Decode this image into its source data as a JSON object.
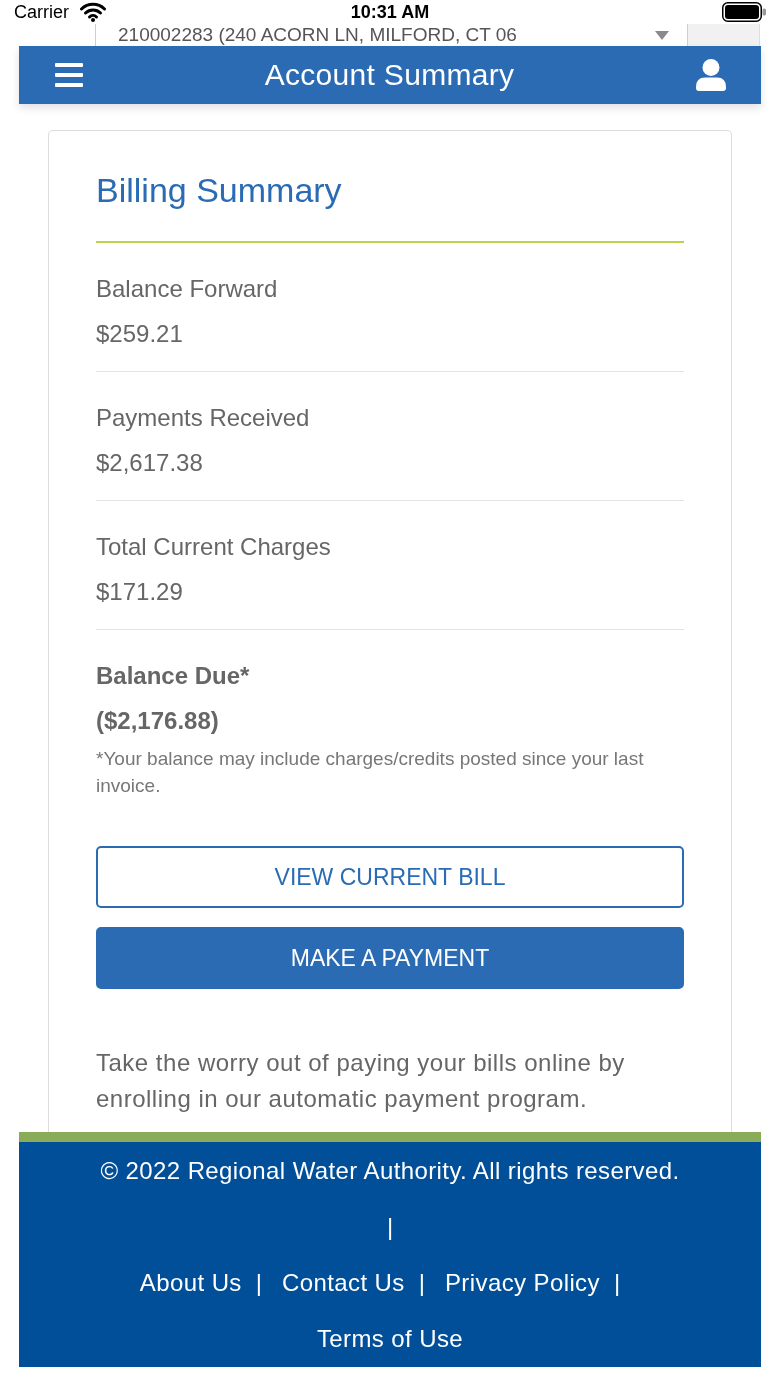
{
  "status_bar": {
    "carrier": "Carrier",
    "time": "10:31 AM"
  },
  "account_selector": {
    "value": "210002283 (240 ACORN LN, MILFORD, CT 06"
  },
  "header": {
    "title": "Account Summary"
  },
  "billing_summary": {
    "title": "Billing Summary",
    "items": [
      {
        "kind": "regular",
        "label": "Balance Forward",
        "amount": "$259.21"
      },
      {
        "kind": "regular",
        "label": "Payments Received",
        "amount": "$2,617.38"
      },
      {
        "kind": "regular",
        "label": "Total Current Charges",
        "amount": "$171.29"
      },
      {
        "kind": "total",
        "label": "Balance Due*",
        "amount": "($2,176.88)"
      }
    ],
    "note": "*Your balance may include charges/credits posted since your last invoice.",
    "buttons": [
      {
        "kind": "outline",
        "label": "VIEW CURRENT BILL"
      },
      {
        "kind": "primary",
        "label": "MAKE A PAYMENT"
      }
    ],
    "autopay_text": "Take the worry out of paying your bills online by enrolling in our automatic payment program."
  },
  "footer": {
    "lines": [
      [
        {
          "kind": "text",
          "label": "© 2022 Regional Water Authority. All rights reserved."
        }
      ],
      [
        {
          "kind": "separator",
          "label": "|"
        }
      ],
      [
        {
          "kind": "link",
          "label": "About Us"
        },
        {
          "kind": "separator",
          "label": "|"
        },
        {
          "kind": "link",
          "label": "Contact Us"
        },
        {
          "kind": "separator",
          "label": "|"
        },
        {
          "kind": "link",
          "label": "Privacy Policy"
        },
        {
          "kind": "separator",
          "label": "|"
        }
      ],
      [
        {
          "kind": "link",
          "label": "Terms of Use"
        }
      ]
    ]
  }
}
